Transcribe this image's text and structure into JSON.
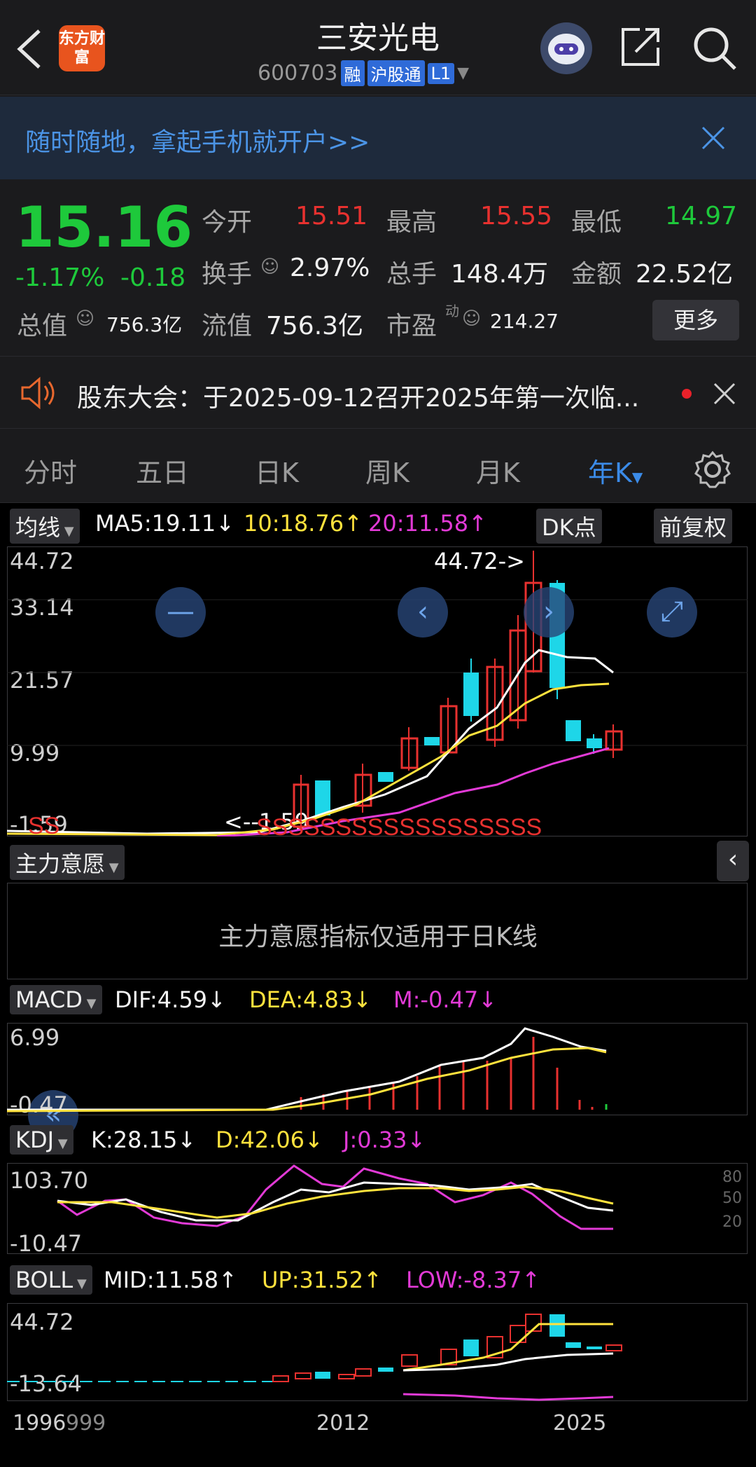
{
  "header": {
    "app_logo_text": "东方财富",
    "title": "三安光电",
    "code": "600703",
    "tags": [
      "融",
      "沪股通",
      "L1"
    ]
  },
  "banner": {
    "text": "随时随地，拿起手机就开户>>"
  },
  "quote": {
    "price": "15.16",
    "change_pct": "-1.17%",
    "change": "-0.18",
    "open_label": "今开",
    "open": "15.51",
    "high_label": "最高",
    "high": "15.55",
    "low_label": "最低",
    "low": "14.97",
    "turnover_label": "换手",
    "turnover": "2.97%",
    "volume_label": "总手",
    "volume": "148.4万",
    "amount_label": "金额",
    "amount": "22.52亿",
    "mktcap_label": "总值",
    "mktcap": "756.3亿",
    "float_label": "流值",
    "float": "756.3亿",
    "pe_label": "市盈",
    "pe_sup": "动",
    "pe": "214.27",
    "more_label": "更多"
  },
  "notice": {
    "text": "股东大会：于2025-09-12召开2025年第一次临..."
  },
  "tabs": [
    "分时",
    "五日",
    "日K",
    "周K",
    "月K",
    "年K"
  ],
  "active_tab": "年K",
  "ma": {
    "selector": "均线",
    "ma5": "MA5:19.11",
    "ma10": "10:18.76",
    "ma20": "20:11.58",
    "dk_btn": "DK点",
    "adj_btn": "前复权",
    "y_labels": [
      "44.72",
      "33.14",
      "21.57",
      "9.99",
      "-1.59"
    ],
    "max_marker": "44.72->",
    "min_marker": "<--1.59"
  },
  "zhuli": {
    "selector": "主力意愿",
    "message": "主力意愿指标仅适用于日K线"
  },
  "macd": {
    "selector": "MACD",
    "dif": "DIF:4.59",
    "dea": "DEA:4.83",
    "m": "M:-0.47",
    "y_labels": [
      "6.99",
      "-0.47"
    ]
  },
  "kdj": {
    "selector": "KDJ",
    "k": "K:28.15",
    "d": "D:42.06",
    "j": "J:0.33",
    "y_labels": [
      "103.70",
      "-10.47"
    ],
    "right_labels": [
      "80",
      "50",
      "20"
    ]
  },
  "boll": {
    "selector": "BOLL",
    "mid": "MID:11.58",
    "up": "UP:31.52",
    "low": "LOW:-8.37",
    "y_labels": [
      "44.72",
      "-13.64"
    ]
  },
  "x_labels": [
    "1996",
    "999",
    "2012",
    "2025"
  ],
  "colors": {
    "up": "#e8312f",
    "down": "#1ed6e8",
    "accent": "#3b8be8",
    "green": "#1ec93b"
  }
}
